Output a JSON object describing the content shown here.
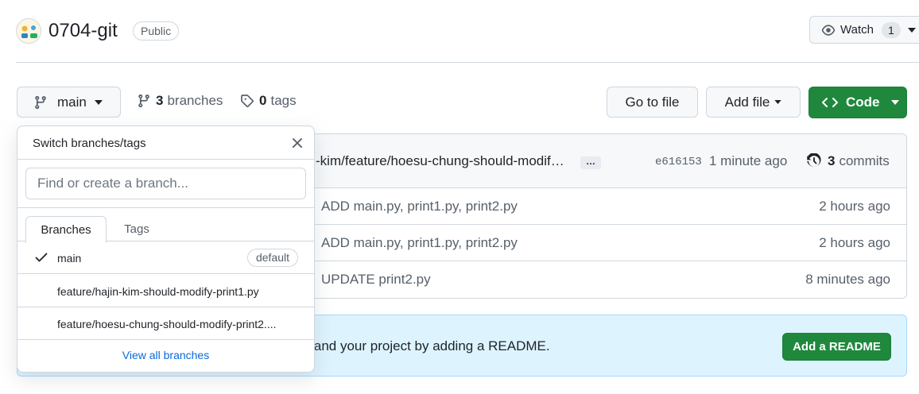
{
  "repo": {
    "name": "0704-git",
    "visibility": "Public",
    "watch_label": "Watch",
    "watch_count": "1"
  },
  "toolbar": {
    "branch_label": "main",
    "branches_count": "3",
    "branches_label": "branches",
    "tags_count": "0",
    "tags_label": "tags",
    "goto_label": "Go to file",
    "addfile_label": "Add file",
    "code_label": "Code"
  },
  "commit": {
    "message": "-kim/feature/hoesu-chung-should-modif…",
    "ellipsis": "…",
    "sha": "e616153",
    "time": "1 minute ago",
    "count": "3",
    "count_label": "commits"
  },
  "files": [
    {
      "message": "ADD main.py, print1.py, print2.py",
      "time": "2 hours ago"
    },
    {
      "message": "ADD main.py, print1.py, print2.py",
      "time": "2 hours ago"
    },
    {
      "message": "UPDATE print2.py",
      "time": "8 minutes ago"
    }
  ],
  "readme": {
    "text": "rstand your project by adding a README.",
    "button": "Add a README"
  },
  "dropdown": {
    "title": "Switch branches/tags",
    "filter_placeholder": "Find or create a branch...",
    "tabs": [
      "Branches",
      "Tags"
    ],
    "items": [
      {
        "name": "main",
        "badge": "default"
      },
      {
        "name": "feature/hajin-kim-should-modify-print1.py"
      },
      {
        "name": "feature/hoesu-chung-should-modify-print2...."
      }
    ],
    "view_all": "View all branches"
  },
  "colors": {
    "primary_green": "#1f883d",
    "link_blue": "#0969da",
    "banner_bg": "#ddf4ff"
  }
}
